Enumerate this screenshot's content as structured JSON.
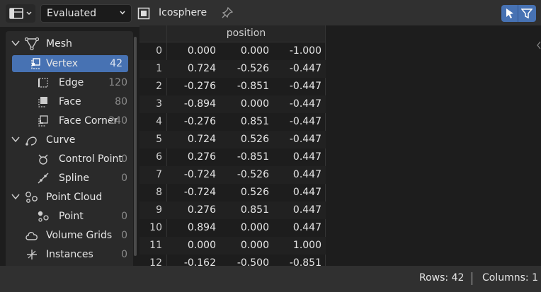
{
  "header": {
    "domain_select": "Evaluated",
    "object_name": "Icosphere"
  },
  "sidebar": {
    "items": [
      {
        "label": "Mesh",
        "count": ""
      },
      {
        "label": "Vertex",
        "count": "42"
      },
      {
        "label": "Edge",
        "count": "120"
      },
      {
        "label": "Face",
        "count": "80"
      },
      {
        "label": "Face Corner",
        "count": "240"
      },
      {
        "label": "Curve",
        "count": ""
      },
      {
        "label": "Control Point",
        "count": "0"
      },
      {
        "label": "Spline",
        "count": "0"
      },
      {
        "label": "Point Cloud",
        "count": ""
      },
      {
        "label": "Point",
        "count": "0"
      },
      {
        "label": "Volume Grids",
        "count": "0"
      },
      {
        "label": "Instances",
        "count": "0"
      }
    ]
  },
  "table": {
    "column": "position",
    "rows": [
      {
        "i": "0",
        "x": "0.000",
        "y": "0.000",
        "z": "-1.000"
      },
      {
        "i": "1",
        "x": "0.724",
        "y": "-0.526",
        "z": "-0.447"
      },
      {
        "i": "2",
        "x": "-0.276",
        "y": "-0.851",
        "z": "-0.447"
      },
      {
        "i": "3",
        "x": "-0.894",
        "y": "0.000",
        "z": "-0.447"
      },
      {
        "i": "4",
        "x": "-0.276",
        "y": "0.851",
        "z": "-0.447"
      },
      {
        "i": "5",
        "x": "0.724",
        "y": "0.526",
        "z": "-0.447"
      },
      {
        "i": "6",
        "x": "0.276",
        "y": "-0.851",
        "z": "0.447"
      },
      {
        "i": "7",
        "x": "-0.724",
        "y": "-0.526",
        "z": "0.447"
      },
      {
        "i": "8",
        "x": "-0.724",
        "y": "0.526",
        "z": "0.447"
      },
      {
        "i": "9",
        "x": "0.276",
        "y": "0.851",
        "z": "0.447"
      },
      {
        "i": "10",
        "x": "0.894",
        "y": "0.000",
        "z": "0.447"
      },
      {
        "i": "11",
        "x": "0.000",
        "y": "0.000",
        "z": "1.000"
      },
      {
        "i": "12",
        "x": "-0.162",
        "y": "-0.500",
        "z": "-0.851"
      }
    ]
  },
  "footer": {
    "rows": "Rows: 42",
    "columns": "Columns: 1"
  }
}
